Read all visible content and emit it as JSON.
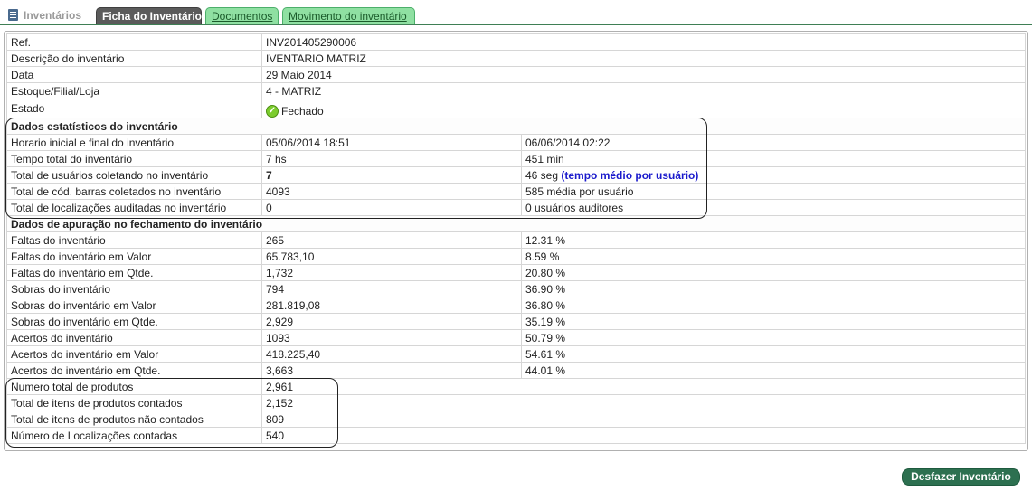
{
  "module": {
    "label": "Inventários",
    "icon": "document-icon"
  },
  "tabs": [
    {
      "label": "Ficha do Inventário",
      "active": true
    },
    {
      "label": "Documentos",
      "active": false
    },
    {
      "label": "Movimento do inventário",
      "active": false
    }
  ],
  "general": {
    "ref": {
      "label": "Ref.",
      "value": "INV201405290006"
    },
    "description": {
      "label": "Descrição do inventário",
      "value": "IVENTARIO MATRIZ"
    },
    "date": {
      "label": "Data",
      "value": "29 Maio 2014"
    },
    "store": {
      "label": "Estoque/Filial/Loja",
      "value": "4 - MATRIZ"
    },
    "status": {
      "label": "Estado",
      "value": "Fechado",
      "icon": "check-circle-icon"
    }
  },
  "stats": {
    "title": "Dados estatísticos do inventário",
    "rows": [
      {
        "label": "Horario inicial e final do inventário",
        "value": "05/06/2014 18:51",
        "extra": "06/06/2014 02:22"
      },
      {
        "label": "Tempo total do inventário",
        "value": "7 hs",
        "extra": "451 min"
      },
      {
        "label": "Total de usuários coletando no inventário",
        "value": "7",
        "extra": "46 seg",
        "extra_note": "(tempo médio por usuário)"
      },
      {
        "label": "Total de cód. barras coletados no inventário",
        "value": "4093",
        "extra": "585 média por usuário"
      },
      {
        "label": "Total de localizações auditadas no inventário",
        "value": "0",
        "extra": "0 usuários auditores"
      }
    ]
  },
  "closing": {
    "title": "Dados de apuração no fechamento do inventário",
    "rows": [
      {
        "label": "Faltas do inventário",
        "value": "265",
        "pct": "12.31 %"
      },
      {
        "label": "Faltas do inventário em Valor",
        "value": "65.783,10",
        "pct": "8.59 %"
      },
      {
        "label": "Faltas do inventário em Qtde.",
        "value": "1,732",
        "pct": "20.80 %"
      },
      {
        "label": "Sobras do inventário",
        "value": "794",
        "pct": "36.90 %"
      },
      {
        "label": "Sobras do inventário em Valor",
        "value": "281.819,08",
        "pct": "36.80 %"
      },
      {
        "label": "Sobras do inventário em Qtde.",
        "value": "2,929",
        "pct": "35.19 %"
      },
      {
        "label": "Acertos do inventário",
        "value": "1093",
        "pct": "50.79 %"
      },
      {
        "label": "Acertos do inventário em Valor",
        "value": "418.225,40",
        "pct": "54.61 %"
      },
      {
        "label": "Acertos do inventário em Qtde.",
        "value": "3,663",
        "pct": "44.01 %"
      }
    ]
  },
  "totals": [
    {
      "label": "Numero total de produtos",
      "value": "2,961"
    },
    {
      "label": "Total de itens de produtos contados",
      "value": "2,152"
    },
    {
      "label": "Total de itens de produtos não contados",
      "value": "809"
    },
    {
      "label": "Número de Localizações contadas",
      "value": "540"
    }
  ],
  "actions": {
    "undo_label": "Desfazer Inventário"
  },
  "colors": {
    "tab_active": "#5b5b5b",
    "tab_inactive": "#8fe0a2",
    "button": "#2d7050",
    "highlight_text": "#1a1acc"
  }
}
